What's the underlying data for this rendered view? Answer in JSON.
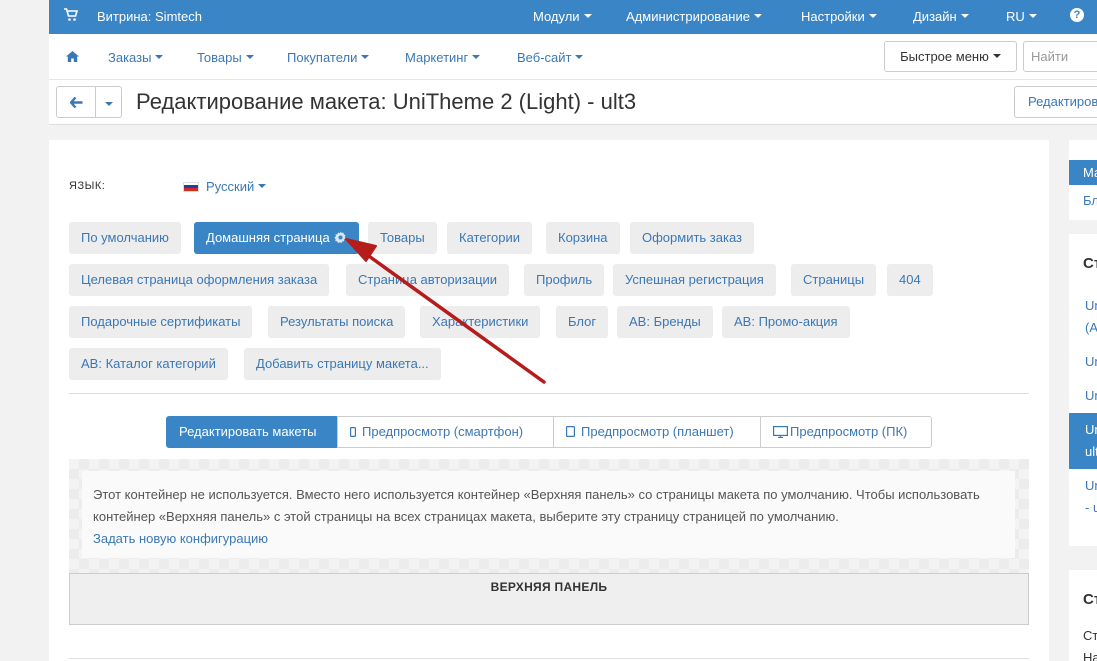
{
  "topbar": {
    "store": "Витрина: Simtech",
    "menu": [
      "Модули",
      "Администрирование",
      "Настройки",
      "Дизайн",
      "RU"
    ],
    "help": "?"
  },
  "subnav": {
    "items": [
      "Заказы",
      "Товары",
      "Покупатели",
      "Маркетинг",
      "Веб-сайт"
    ],
    "quick_menu": "Быстрое меню",
    "search_placeholder": "Найти"
  },
  "title": {
    "text": "Редактирование макета: UniTheme 2 (Light) - ult3",
    "edit_button": "Редактиров"
  },
  "language": {
    "label": "ЯЗЫК:",
    "value": "Русский"
  },
  "layout_tabs": [
    "По умолчанию",
    "Домашняя страница",
    "Товары",
    "Категории",
    "Корзина",
    "Оформить заказ",
    "Целевая страница оформления заказа",
    "Страница авторизации",
    "Профиль",
    "Успешная регистрация",
    "Страницы",
    "404",
    "Подарочные сертификаты",
    "Результаты поиска",
    "Характеристики",
    "Блог",
    "AB: Бренды",
    "AB: Промо-акция",
    "AB: Каталог категорий",
    "Добавить страницу макета..."
  ],
  "active_tab": "Домашняя страница",
  "modes": [
    "Редактировать макеты",
    "Предпросмотр (смартфон)",
    "Предпросмотр (планшет)",
    "Предпросмотр (ПК)"
  ],
  "notice": {
    "text": "Этот контейнер не используется. Вместо него используется контейнер «Верхняя панель» со страницы макета по умолчанию. Чтобы использовать контейнер «Верхняя панель» с этой страницы на всех страницах макета, выберите эту страницу страницей по умолчанию.",
    "link": "Задать новую конфигурацию"
  },
  "container_title": "ВЕРХНЯЯ ПАНЕЛЬ",
  "sidebar": {
    "active_item": "Ма",
    "item": "Бл",
    "section_header": "Ст",
    "links": [
      "Un",
      "(А",
      "Un",
      "Un"
    ],
    "selected": [
      "Un",
      "ult"
    ],
    "links_after": [
      "Un",
      "- u"
    ],
    "section2_header": "Ст",
    "section2_text": [
      "Ст",
      "На"
    ]
  },
  "colors": {
    "brand_blue": "#3a85c6",
    "link_blue": "#3a78b5",
    "arrow_red": "#b51c1c"
  }
}
